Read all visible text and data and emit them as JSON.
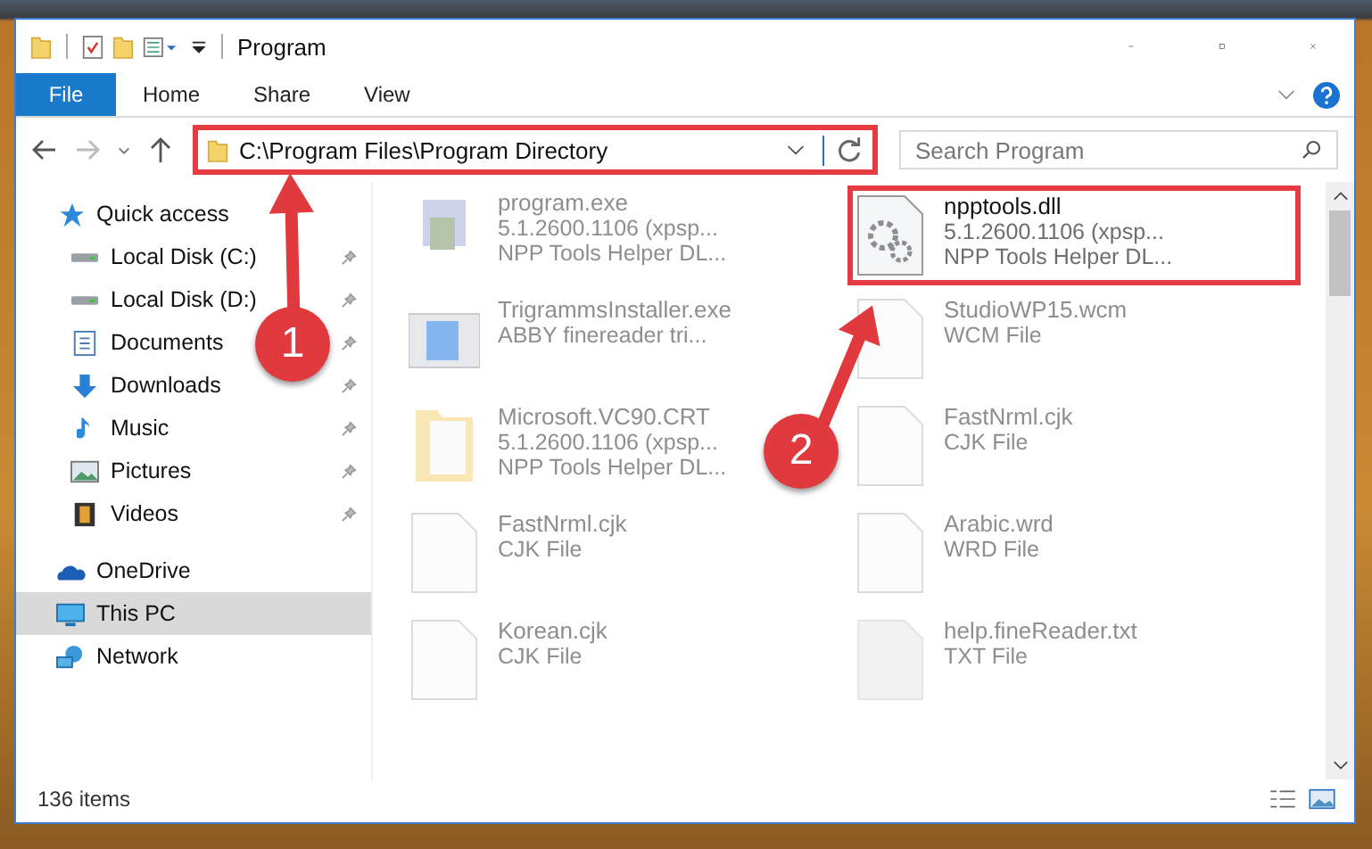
{
  "window": {
    "title": "Program"
  },
  "ribbon_tabs": [
    {
      "label": "File",
      "kind": "file"
    },
    {
      "label": "Home",
      "kind": "tab"
    },
    {
      "label": "Share",
      "kind": "tab"
    },
    {
      "label": "View",
      "kind": "tab"
    }
  ],
  "address": {
    "path": "C:\\Program Files\\Program Directory",
    "highlighted": true
  },
  "search": {
    "placeholder": "Search Program"
  },
  "sidebar": {
    "items": [
      {
        "label": "Quick access",
        "kind": "star",
        "selected": false,
        "children": [
          {
            "label": "Local Disk (C:)",
            "kind": "drive",
            "pinned": true
          },
          {
            "label": "Local Disk (D:)",
            "kind": "drive",
            "pinned": true
          },
          {
            "label": "Documents",
            "kind": "documents",
            "pinned": true
          },
          {
            "label": "Downloads",
            "kind": "downloads",
            "pinned": true
          },
          {
            "label": "Music",
            "kind": "music",
            "pinned": true
          },
          {
            "label": "Pictures",
            "kind": "pictures",
            "pinned": true
          },
          {
            "label": "Videos",
            "kind": "videos",
            "pinned": true
          }
        ]
      },
      {
        "label": "OneDrive",
        "kind": "cloud",
        "selected": false
      },
      {
        "label": "This PC",
        "kind": "computer",
        "selected": true
      },
      {
        "label": "Network",
        "kind": "network",
        "selected": false
      }
    ]
  },
  "files": [
    {
      "name": "program.exe",
      "details": [
        "5.1.2600.1106 (xpsp...",
        "NPP Tools Helper DL..."
      ],
      "kind": "exe",
      "blurred": true,
      "highlighted": false
    },
    {
      "name": "npptools.dll",
      "details": [
        "5.1.2600.1106 (xpsp...",
        "NPP Tools Helper DL..."
      ],
      "kind": "settings",
      "blurred": false,
      "highlighted": true
    },
    {
      "name": "TrigrammsInstaller.exe",
      "details": [
        "ABBY finereader tri..."
      ],
      "kind": "installer",
      "blurred": true,
      "highlighted": false
    },
    {
      "name": "StudioWP15.wcm",
      "details": [
        "WCM File"
      ],
      "kind": "document",
      "blurred": true,
      "highlighted": false
    },
    {
      "name": "Microsoft.VC90.CRT",
      "details": [
        "5.1.2600.1106 (xpsp...",
        "NPP Tools Helper DL..."
      ],
      "kind": "folder",
      "blurred": true,
      "highlighted": false
    },
    {
      "name": "FastNrml.cjk",
      "details": [
        "CJK File"
      ],
      "kind": "document",
      "blurred": true,
      "highlighted": false
    },
    {
      "name": "FastNrml.cjk",
      "details": [
        "CJK File"
      ],
      "kind": "document",
      "blurred": true,
      "highlighted": false
    },
    {
      "name": "Arabic.wrd",
      "details": [
        "WRD File"
      ],
      "kind": "document",
      "blurred": true,
      "highlighted": false
    },
    {
      "name": "Korean.cjk",
      "details": [
        "CJK File"
      ],
      "kind": "document",
      "blurred": true,
      "highlighted": false
    },
    {
      "name": "help.fineReader.txt",
      "details": [
        "TXT File"
      ],
      "kind": "text",
      "blurred": true,
      "highlighted": false
    }
  ],
  "status_bar": {
    "item_count": "136 items"
  },
  "annotations": [
    {
      "number": "1"
    },
    {
      "number": "2"
    }
  ]
}
